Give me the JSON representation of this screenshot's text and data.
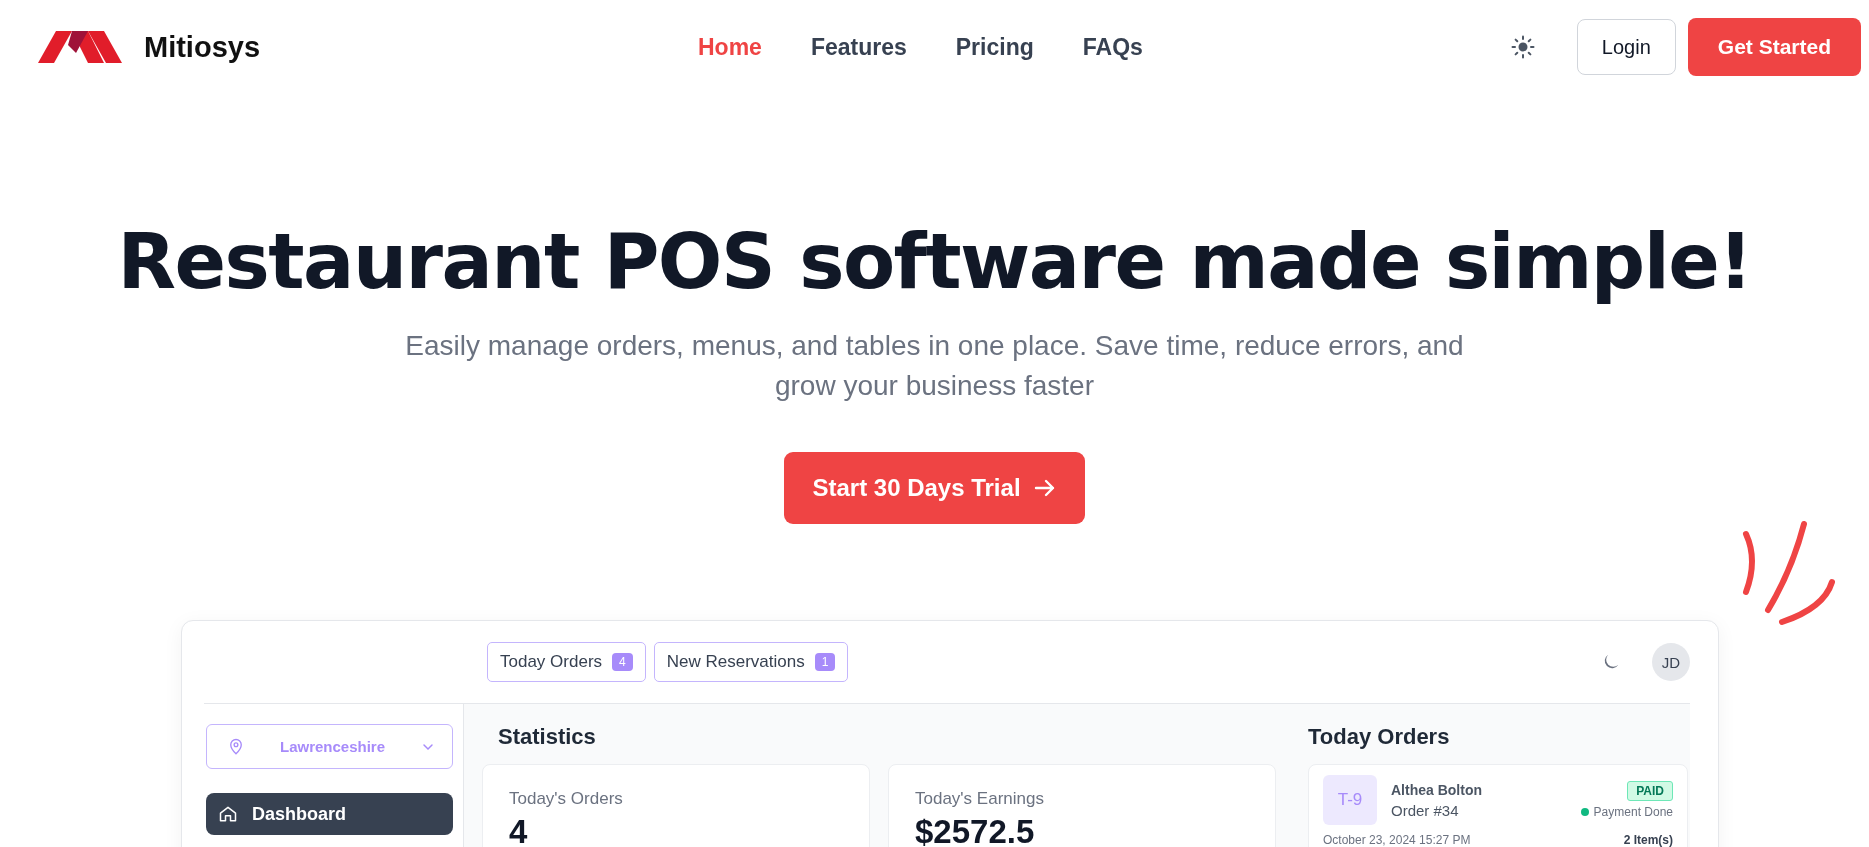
{
  "header": {
    "brand": "Mitiosys",
    "nav": [
      {
        "label": "Home",
        "selected": true
      },
      {
        "label": "Features",
        "selected": false
      },
      {
        "label": "Pricing",
        "selected": false
      },
      {
        "label": "FAQs",
        "selected": false
      }
    ],
    "login": "Login",
    "cta": "Get Started"
  },
  "hero": {
    "title": "Restaurant POS software made simple!",
    "subtitle": "Easily manage orders, menus, and tables in one place. Save time, reduce errors, and grow your business faster",
    "button": "Start 30 Days Trial"
  },
  "dashboard": {
    "tabs": [
      {
        "label": "Today Orders",
        "count": "4"
      },
      {
        "label": "New Reservations",
        "count": "1"
      }
    ],
    "avatar": "JD",
    "location": "Lawrenceshire",
    "menu": [
      {
        "label": "Dashboard",
        "selected": true
      }
    ],
    "statistics": {
      "title": "Statistics",
      "cards": [
        {
          "label": "Today's Orders",
          "value": "4"
        },
        {
          "label": "Today's Earnings",
          "value": "$2572.5"
        }
      ]
    },
    "orders": {
      "title": "Today Orders",
      "items": [
        {
          "table": "T-9",
          "customer": "Althea Bolton",
          "order": "Order #34",
          "badge": "PAID",
          "status": "Payment Done",
          "color": "#10b981",
          "date": "October 23, 2024 15:27 PM",
          "items": "2 Item(s)"
        }
      ]
    }
  }
}
